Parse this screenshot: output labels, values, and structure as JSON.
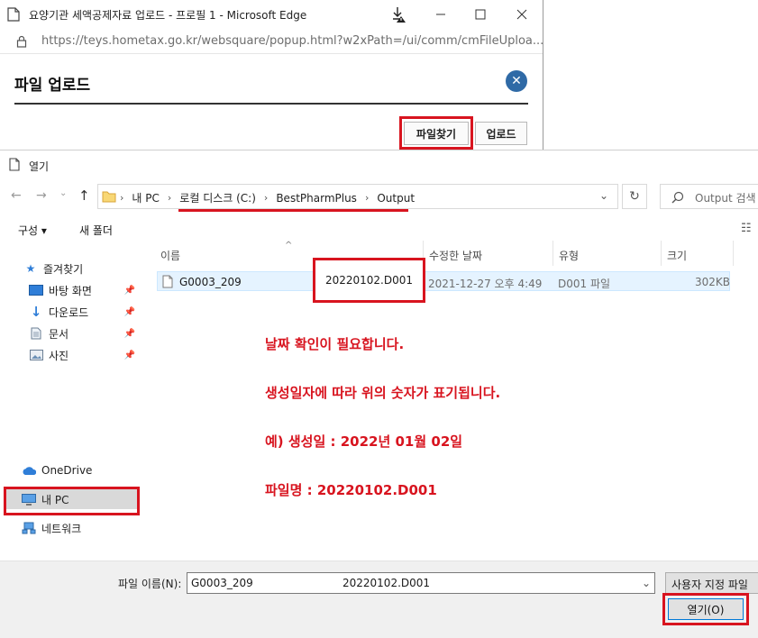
{
  "browser": {
    "window_title": "요양기관 세액공제자료 업로드 - 프로필 1 - Microsoft Edge",
    "url": "https://teys.hometax.go.kr/websquare/popup.html?w2xPath=/ui/comm/cmFileUploa..."
  },
  "popup": {
    "title": "파일 업로드",
    "find_file_label": "파일찾기",
    "upload_label": "업로드"
  },
  "dialog": {
    "title": "열기",
    "breadcrumbs": [
      "내 PC",
      "로컬 디스크 (C:)",
      "BestPharmPlus",
      "Output"
    ],
    "search_placeholder": "Output 검색",
    "toolbar": {
      "organize": "구성 ▾",
      "new_folder": "새 폴더"
    },
    "nav": {
      "favorites": "즐겨찾기",
      "quick": [
        {
          "label": "바탕 화면",
          "icon": "desktop-icon"
        },
        {
          "label": "다운로드",
          "icon": "download-icon"
        },
        {
          "label": "문서",
          "icon": "document-icon"
        },
        {
          "label": "사진",
          "icon": "picture-icon"
        }
      ],
      "onedrive": "OneDrive",
      "this_pc": "내 PC",
      "network": "네트워크"
    },
    "columns": {
      "name": "이름",
      "modified": "수정한 날짜",
      "type": "유형",
      "size": "크기"
    },
    "file": {
      "name": "G0003_209",
      "annotation": "20220102.D001",
      "modified": "2021-12-27 오후 4:49",
      "type": "D001 파일",
      "size": "302KB"
    },
    "notes": [
      "날짜 확인이 필요합니다.",
      "생성일자에 따라 위의 숫자가 표기됩니다.",
      "예) 생성일 : 2022년 01월 02일",
      "파일명 : 20220102.D001"
    ],
    "footer": {
      "filename_label": "파일 이름(N):",
      "filename_value": "G0003_209",
      "filename_annotation": "20220102.D001",
      "filetype": "사용자 지정 파일",
      "open_label": "열기(O)"
    }
  },
  "colors": {
    "highlight_red": "#d8141f",
    "close_blue": "#2f6aa6",
    "selection": "#e5f3ff"
  }
}
